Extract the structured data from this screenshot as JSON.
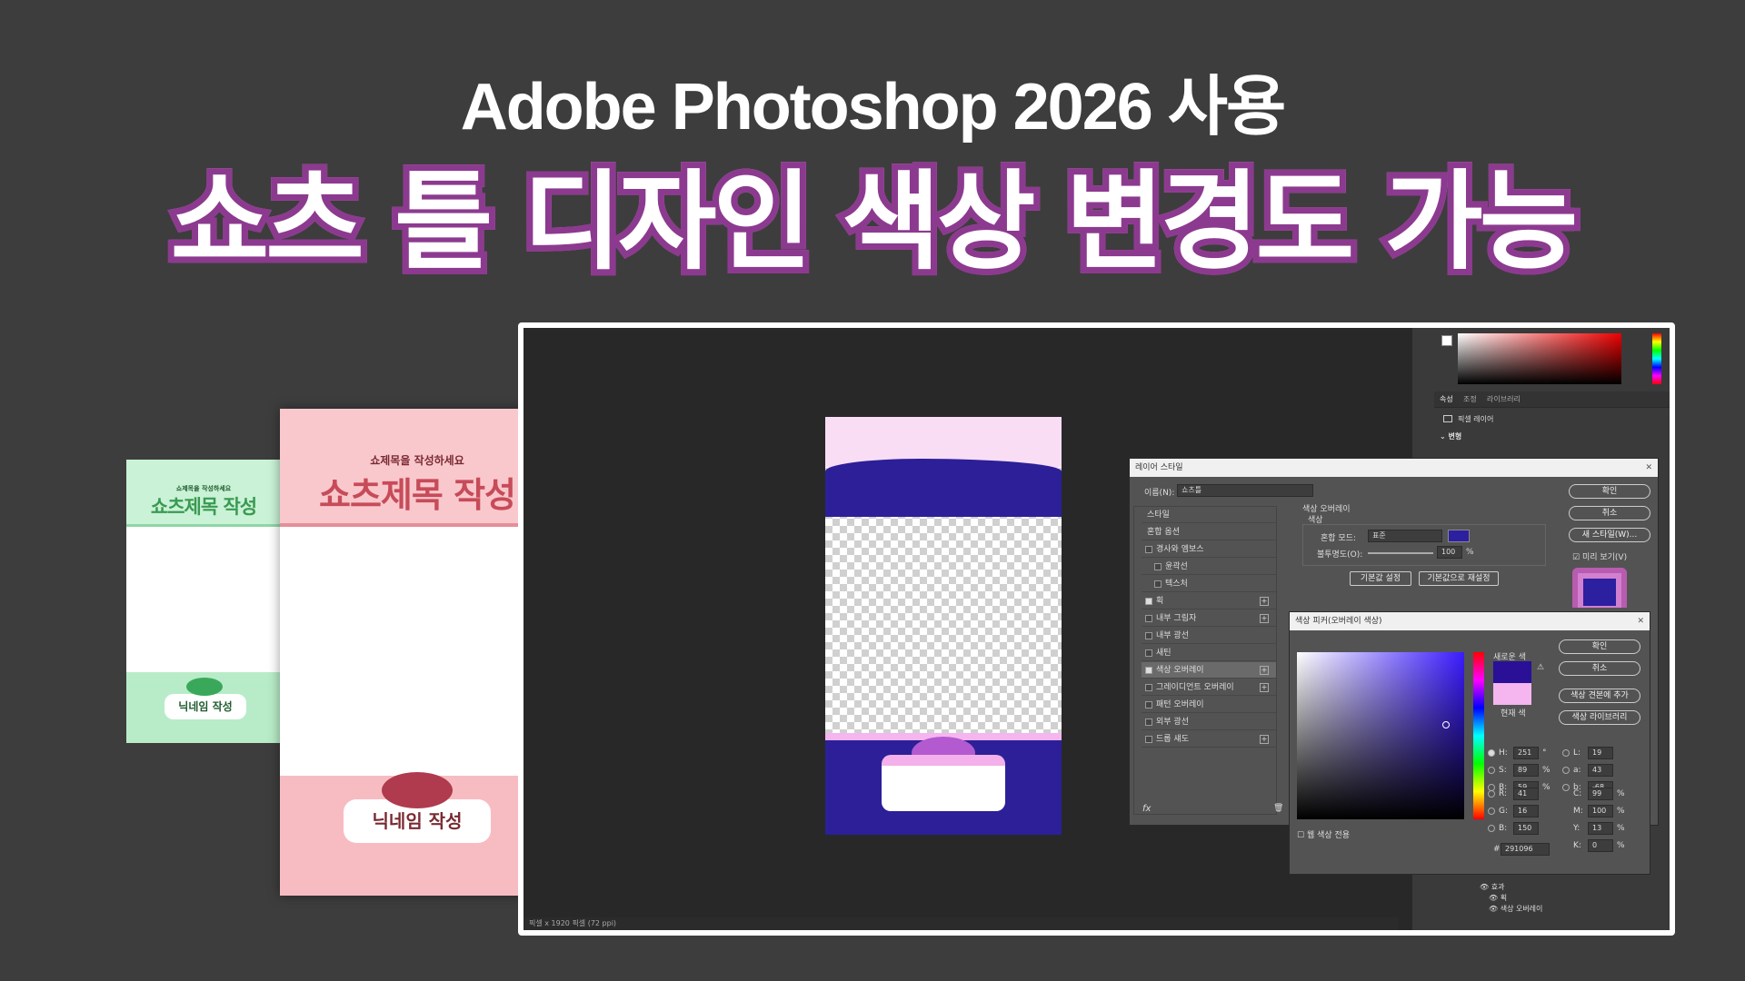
{
  "headline": {
    "line1": "Adobe Photoshop 2026 사용",
    "line2": "쇼츠 틀 디자인 색상 변경도 가능"
  },
  "thumbnails": {
    "subtitle": "쇼제목을 작성하세요",
    "subtitle_main": "쇼제목을 작성하세요",
    "title": "쇼츠제목 작성",
    "nickname": "닉네임 작성",
    "colors": {
      "green": "#a9e8bf",
      "pink": "#f7b7bf",
      "purple": "#d6b2f0",
      "navy": "#2c1f98"
    }
  },
  "photoshop": {
    "status": "픽셀 x 1920 픽셀 (72 ppi)",
    "right_panel": {
      "tabs": [
        "속성",
        "조정",
        "라이브러리"
      ],
      "layer_type": "픽셀 레이어",
      "section": "변형",
      "effects": {
        "root": "효과",
        "items": [
          "획",
          "색상 오버레이"
        ]
      }
    },
    "layer_style": {
      "title": "레이어 스타일",
      "name_label": "이름(N):",
      "name_value": "쇼츠틀",
      "buttons": {
        "ok": "확인",
        "cancel": "취소",
        "new_style": "새 스타일(W)...",
        "preview": "미리 보기(V)"
      },
      "list": [
        {
          "label": "스타일",
          "checkbox": false,
          "plus": false,
          "header": true
        },
        {
          "label": "혼합 옵션",
          "checkbox": false,
          "plus": false,
          "header": true
        },
        {
          "label": "경사와 엠보스",
          "checkbox": true,
          "checked": false,
          "plus": false
        },
        {
          "label": "윤곽선",
          "checkbox": true,
          "checked": false,
          "plus": false,
          "indent": true
        },
        {
          "label": "텍스처",
          "checkbox": true,
          "checked": false,
          "plus": false,
          "indent": true
        },
        {
          "label": "획",
          "checkbox": true,
          "checked": true,
          "plus": true
        },
        {
          "label": "내부 그림자",
          "checkbox": true,
          "checked": false,
          "plus": true
        },
        {
          "label": "내부 광선",
          "checkbox": true,
          "checked": false,
          "plus": false
        },
        {
          "label": "새틴",
          "checkbox": true,
          "checked": false,
          "plus": false
        },
        {
          "label": "색상 오버레이",
          "checkbox": true,
          "checked": true,
          "plus": true,
          "selected": true
        },
        {
          "label": "그레이디언트 오버레이",
          "checkbox": true,
          "checked": false,
          "plus": true
        },
        {
          "label": "패턴 오버레이",
          "checkbox": true,
          "checked": false,
          "plus": false
        },
        {
          "label": "외부 광선",
          "checkbox": true,
          "checked": false,
          "plus": false
        },
        {
          "label": "드롭 섀도",
          "checkbox": true,
          "checked": false,
          "plus": true
        }
      ],
      "section_title": "색상 오버레이",
      "group_title": "색상",
      "blend_label": "혼합 모드:",
      "blend_value": "표준",
      "opacity_label": "불투명도(O):",
      "opacity_value": "100",
      "opacity_unit": "%",
      "overlay_color": "#2c1fa0",
      "default_btn": "기본값 설정",
      "reset_btn": "기본값으로 재설정"
    },
    "color_picker": {
      "title": "색상 피커(오버레이 색상)",
      "new_label": "새로운 색",
      "current_label": "현재 색",
      "new_color": "#291096",
      "current_color": "#f5b5ee",
      "buttons": {
        "ok": "확인",
        "cancel": "취소",
        "add_swatch": "색상 견본에 추가",
        "libraries": "색상 라이브러리"
      },
      "web_only": "웹 색상 전용",
      "hsb": [
        {
          "k": "H:",
          "v": "251",
          "u": "°"
        },
        {
          "k": "S:",
          "v": "89",
          "u": "%"
        },
        {
          "k": "B:",
          "v": "59",
          "u": "%"
        }
      ],
      "rgb": [
        {
          "k": "R:",
          "v": "41"
        },
        {
          "k": "G:",
          "v": "16"
        },
        {
          "k": "B:",
          "v": "150"
        }
      ],
      "lab": [
        {
          "k": "L:",
          "v": "19"
        },
        {
          "k": "a:",
          "v": "43"
        },
        {
          "k": "b:",
          "v": "-68"
        }
      ],
      "cmyk": [
        {
          "k": "C:",
          "v": "99",
          "u": "%"
        },
        {
          "k": "M:",
          "v": "100",
          "u": "%"
        },
        {
          "k": "Y:",
          "v": "13",
          "u": "%"
        },
        {
          "k": "K:",
          "v": "0",
          "u": "%"
        }
      ],
      "hex_label": "#",
      "hex": "291096"
    }
  }
}
